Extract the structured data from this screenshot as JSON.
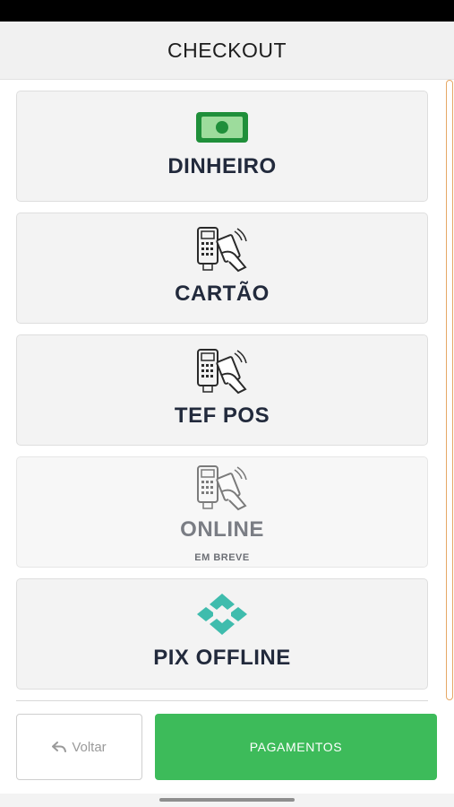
{
  "header": {
    "title": "CHECKOUT"
  },
  "payment_options": [
    {
      "label": "DINHEIRO",
      "icon": "cash-icon"
    },
    {
      "label": "CARTÃO",
      "icon": "card-terminal-icon"
    },
    {
      "label": "TEF POS",
      "icon": "card-terminal-icon"
    },
    {
      "label": "ONLINE",
      "sublabel": "EM BREVE",
      "icon": "card-terminal-icon"
    },
    {
      "label": "PIX OFFLINE",
      "icon": "pix-icon"
    }
  ],
  "footer": {
    "back_label": "Voltar",
    "pay_label": "PAGAMENTOS"
  },
  "colors": {
    "primary_green": "#3dbb5a",
    "pix_teal": "#3fbcad",
    "scroll_accent": "#e6a866"
  }
}
